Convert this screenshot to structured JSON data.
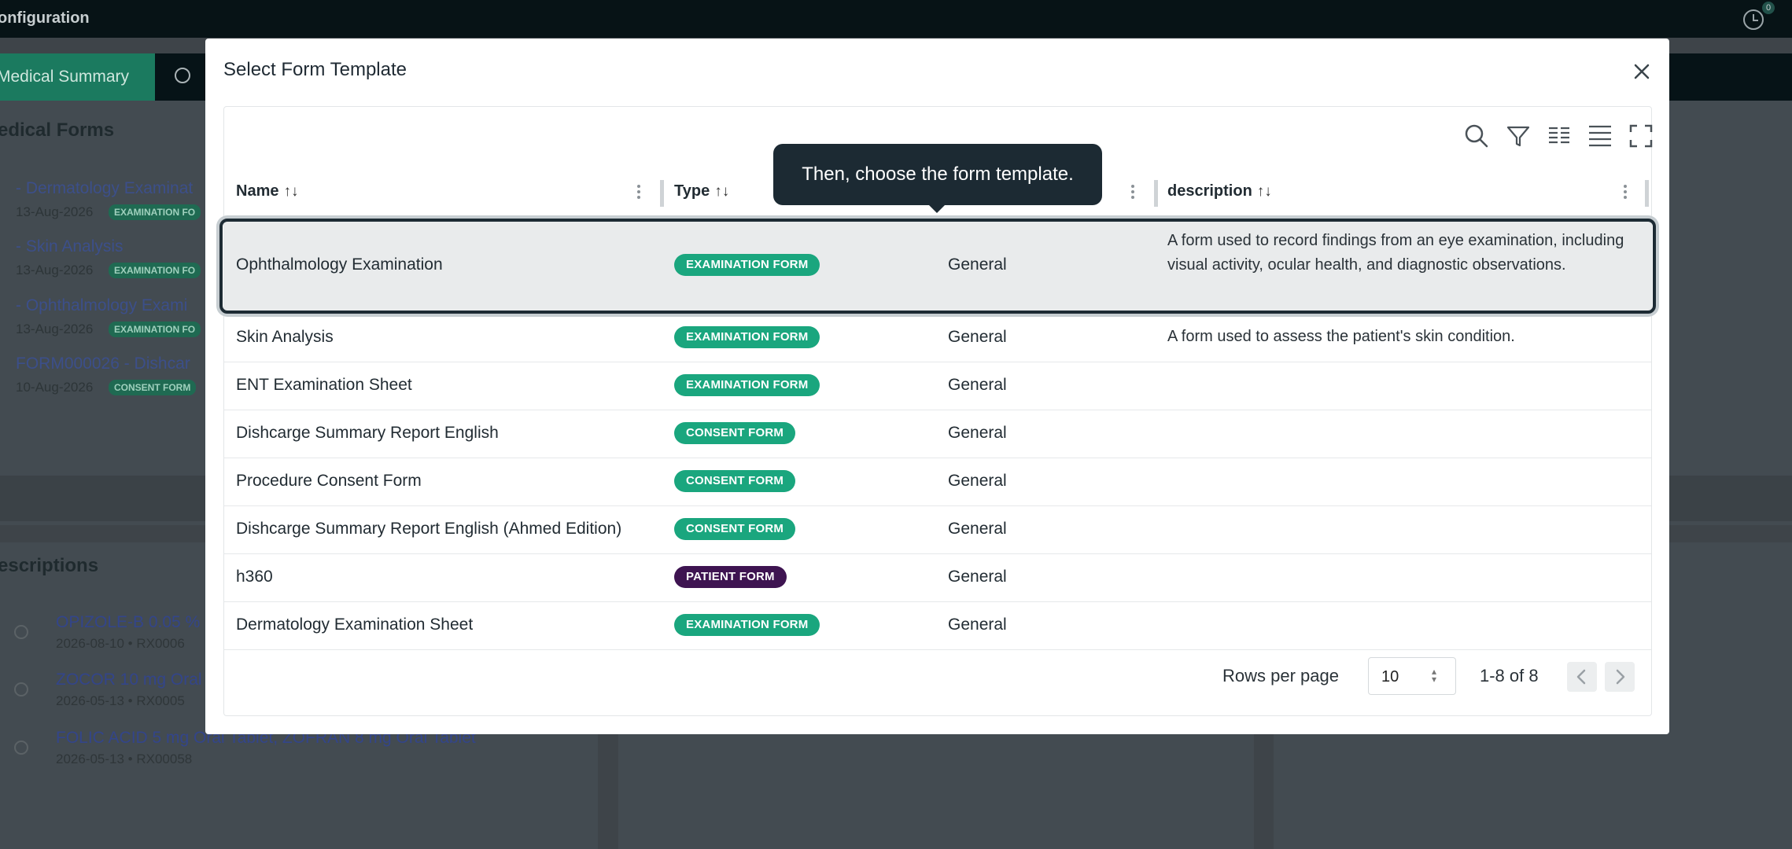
{
  "app": {
    "title": "onfiguration",
    "notification_count": "0",
    "active_tab": "Medical Summary"
  },
  "background": {
    "medical_forms_title": "edical Forms",
    "forms": [
      {
        "name": "- Dermatology Examinat",
        "date": "13-Aug-2026",
        "badge": "EXAMINATION FO"
      },
      {
        "name": "- Skin Analysis",
        "date": "13-Aug-2026",
        "badge": "EXAMINATION FO"
      },
      {
        "name": "- Ophthalmology Exami",
        "date": "13-Aug-2026",
        "badge": "EXAMINATION FO"
      },
      {
        "name": "FORM000026 - Dishcar",
        "date": "10-Aug-2026",
        "badge": "CONSENT FORM"
      }
    ],
    "prescriptions_title": "escriptions",
    "prescriptions": [
      {
        "name": "OPIZOLE-B 0.05 %",
        "meta": "2026-08-10 • RX0006"
      },
      {
        "name": "ZOCOR 10 mg Oral",
        "meta": "2026-05-13 • RX0005"
      },
      {
        "name": "FOLIC ACID 5 mg Oral Tablet, ZOFRAN 8 mg Oral Tablet",
        "meta": "2026-05-13 • RX00058"
      }
    ]
  },
  "modal": {
    "title": "Select Form Template",
    "columns": {
      "name": "Name",
      "type": "Type",
      "description": "description",
      "sort_glyph": "↑↓"
    },
    "rows": [
      {
        "name": "Ophthalmology Examination",
        "type": "EXAMINATION FORM",
        "category": "General",
        "description": "A form used to record findings from an eye examination, including visual activity, ocular health, and diagnostic observations."
      },
      {
        "name": "Skin Analysis",
        "type": "EXAMINATION FORM",
        "category": "General",
        "description": "A form used to assess the patient's skin condition."
      },
      {
        "name": "ENT Examination Sheet",
        "type": "EXAMINATION FORM",
        "category": "General",
        "description": ""
      },
      {
        "name": "Dishcarge Summary Report English",
        "type": "CONSENT FORM",
        "category": "General",
        "description": ""
      },
      {
        "name": "Procedure Consent Form",
        "type": "CONSENT FORM",
        "category": "General",
        "description": ""
      },
      {
        "name": "Dishcarge Summary Report English (Ahmed Edition)",
        "type": "CONSENT FORM",
        "category": "General",
        "description": ""
      },
      {
        "name": "h360",
        "type": "PATIENT FORM",
        "category": "General",
        "description": ""
      },
      {
        "name": "Dermatology Examination Sheet",
        "type": "EXAMINATION FORM",
        "category": "General",
        "description": ""
      }
    ],
    "pagination": {
      "rows_per_page_label": "Rows per page",
      "rows_per_page": "10",
      "range": "1-8 of 8"
    }
  },
  "tooltip": {
    "text": "Then, choose the form template."
  },
  "colors": {
    "examination_badge": "#1aa67e",
    "consent_badge": "#1aa67e",
    "patient_badge": "#3e1451",
    "accent": "#1b7a5f"
  }
}
